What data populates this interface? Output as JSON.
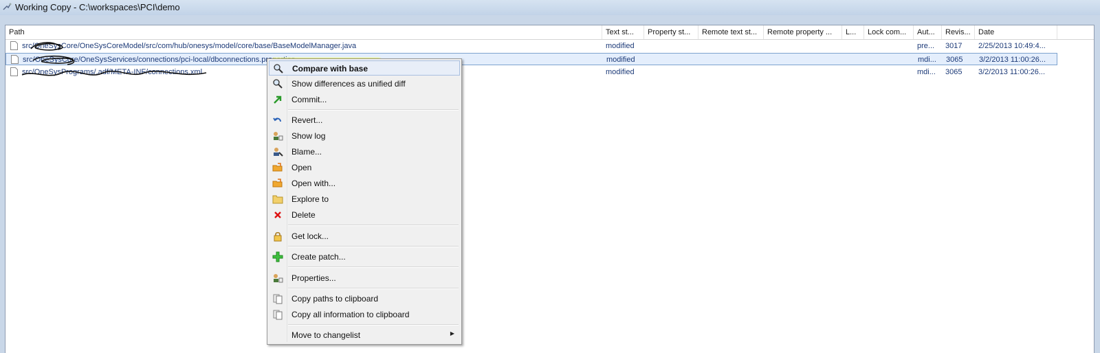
{
  "window": {
    "title": "Working Copy - C:\\workspaces\\PCI\\demo"
  },
  "columns": [
    {
      "key": "path",
      "label": "Path"
    },
    {
      "key": "text_status",
      "label": "Text st..."
    },
    {
      "key": "property_status",
      "label": "Property st..."
    },
    {
      "key": "remote_text",
      "label": "Remote text st..."
    },
    {
      "key": "remote_property",
      "label": "Remote property ..."
    },
    {
      "key": "lock",
      "label": "L..."
    },
    {
      "key": "lock_comment",
      "label": "Lock com..."
    },
    {
      "key": "author",
      "label": "Aut..."
    },
    {
      "key": "revision",
      "label": "Revis..."
    },
    {
      "key": "date",
      "label": "Date"
    }
  ],
  "rows": [
    {
      "path": "src/OneSysCore/OneSysCoreModel/src/com/hub/onesys/model/core/base/BaseModelManager.java",
      "text_status": "modified",
      "author": "pre...",
      "revision": "3017",
      "date": "2/25/2013 10:49:4..."
    },
    {
      "path": "src/OneSysCore/OneSysServices/connections/pci-local/dbconnections.properties",
      "text_status": "modified",
      "author": "mdi...",
      "revision": "3065",
      "date": "3/2/2013 11:00:26..."
    },
    {
      "path": "src/OneSysPrograms/.adf/META-INF/connections.xml",
      "text_status": "modified",
      "author": "mdi...",
      "revision": "3065",
      "date": "3/2/2013 11:00:26..."
    }
  ],
  "context_menu": {
    "items": [
      {
        "label": "Compare with base",
        "icon": "magnifier-diff-icon"
      },
      {
        "label": "Show differences as unified diff",
        "icon": "magnifier-diff-icon"
      },
      {
        "label": "Commit...",
        "icon": "commit-arrow-icon"
      },
      {
        "label": "Revert...",
        "icon": "revert-arrow-icon"
      },
      {
        "label": "Show log",
        "icon": "log-icon"
      },
      {
        "label": "Blame...",
        "icon": "blame-icon"
      },
      {
        "label": "Open",
        "icon": "open-icon"
      },
      {
        "label": "Open with...",
        "icon": "open-with-icon"
      },
      {
        "label": "Explore to",
        "icon": "folder-icon"
      },
      {
        "label": "Delete",
        "icon": "delete-x-icon"
      },
      {
        "label": "Get lock...",
        "icon": "lock-icon"
      },
      {
        "label": "Create patch...",
        "icon": "patch-icon"
      },
      {
        "label": "Properties...",
        "icon": "properties-icon"
      },
      {
        "label": "Copy paths to clipboard",
        "icon": "clipboard-icon"
      },
      {
        "label": "Copy all information to clipboard",
        "icon": "clipboard-icon"
      },
      {
        "label": "Move to changelist",
        "icon": ""
      }
    ]
  },
  "colors": {
    "title_bg": "#c9d7e8",
    "selection_border": "#7da2ce",
    "highlight_yellow": "#f7ff3a",
    "status_text": "#1c3a78"
  }
}
